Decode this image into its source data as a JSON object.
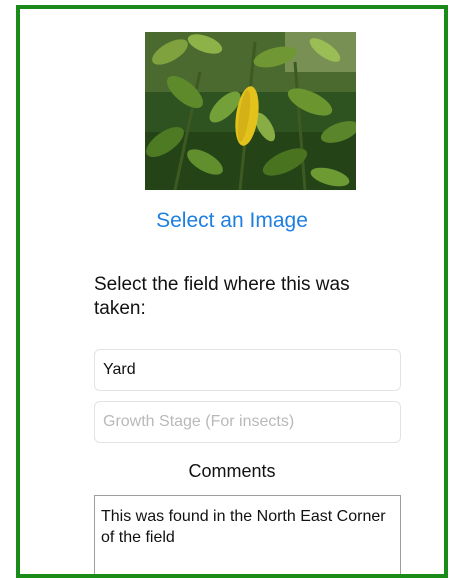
{
  "image": {
    "icon": "plant-photo"
  },
  "select_image_label": "Select an Image",
  "field_prompt": "Select the field where this was taken:",
  "field_input": {
    "value": "Yard"
  },
  "growth_stage_input": {
    "placeholder": "Growth Stage (For insects)"
  },
  "comments_label": "Comments",
  "comments_box": {
    "value": "This was found in the North East Corner of the field"
  },
  "colors": {
    "frame_border": "#1a8a1a",
    "link": "#1f7fe0"
  }
}
